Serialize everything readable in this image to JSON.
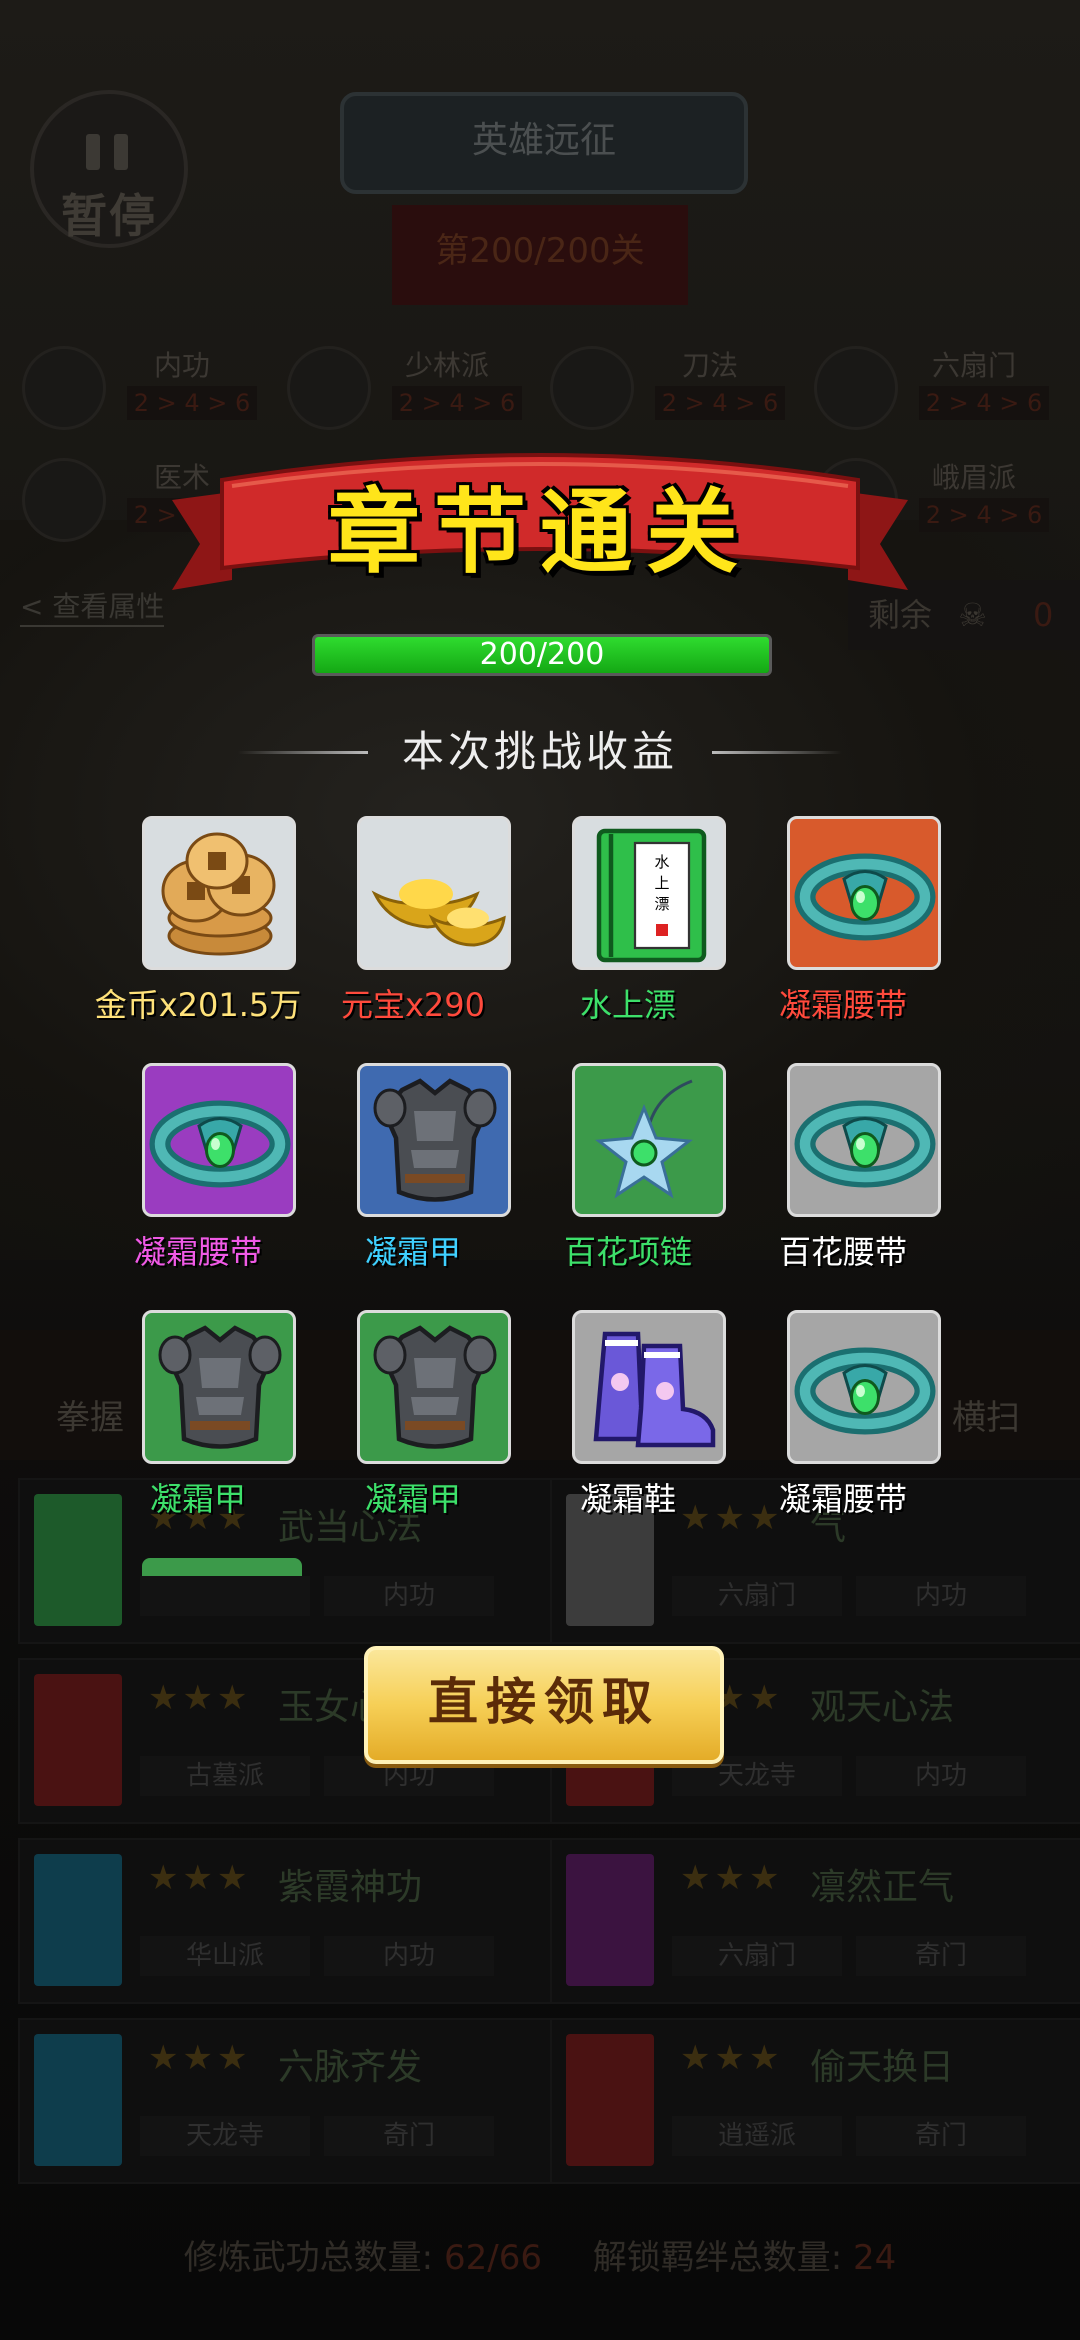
{
  "hud": {
    "pause_label": "暂停",
    "title": "英雄远征",
    "level": "第200/200关"
  },
  "categories": [
    {
      "name": "内功",
      "progress": "2 > 4 > 6"
    },
    {
      "name": "少林派",
      "progress": "2 > 4 > 6"
    },
    {
      "name": "刀法",
      "progress": "2 > 4 > 6"
    },
    {
      "name": "六扇门",
      "progress": "2 > 4 > 6"
    },
    {
      "name": "医术",
      "progress": "2 > 4 > 6"
    },
    {
      "name": "峨眉派",
      "progress": "2 > 4 > 6"
    }
  ],
  "view_attributes": "< 查看属性",
  "remaining": {
    "label": "剩余",
    "value": "0"
  },
  "skill_strip": {
    "left": "拳握",
    "right": "横扫"
  },
  "books": [
    {
      "title": "武当心法",
      "color": "#1d5a2a",
      "tags": [
        "",
        "内功"
      ]
    },
    {
      "title": "气",
      "color": "#3c3c3c",
      "tags": [
        "六扇门",
        "内功"
      ]
    },
    {
      "title": "玉女心经",
      "color": "#4a1212",
      "tags": [
        "古墓派",
        "内功"
      ]
    },
    {
      "title": "观天心法",
      "color": "#4a1212",
      "tags": [
        "天龙寺",
        "内功"
      ]
    },
    {
      "title": "紫霞神功",
      "color": "#0e3d4c",
      "tags": [
        "华山派",
        "内功"
      ]
    },
    {
      "title": "凛然正气",
      "color": "#3b1340",
      "tags": [
        "六扇门",
        "奇门"
      ]
    },
    {
      "title": "六脉齐发",
      "color": "#0e3d4c",
      "tags": [
        "天龙寺",
        "奇门"
      ]
    },
    {
      "title": "偷天换日",
      "color": "#4a1212",
      "tags": [
        "逍遥派",
        "奇门"
      ]
    }
  ],
  "bottom_stats": {
    "label_a": "修炼武功总数量:",
    "value_a": "62/66",
    "label_b": "解锁羁绊总数量:",
    "value_b": "24"
  },
  "popup": {
    "banner": "章节通关",
    "progress_text": "200/200",
    "progress_fraction": 1.0,
    "rewards_title": "本次挑战收益",
    "claim_button": "直接领取"
  },
  "rewards": [
    {
      "label": "金币x201.5万",
      "color": "#ffe27a",
      "bg": "#d8dde0",
      "icon": "coins-icon"
    },
    {
      "label": "元宝x290",
      "color": "#ff4a3c",
      "bg": "#d8dde0",
      "icon": "gold-ingot-icon"
    },
    {
      "label": "水上漂",
      "color": "#3de06a",
      "bg": "#d8dde0",
      "icon": "skill-book-icon"
    },
    {
      "label": "凝霜腰带",
      "color": "#ff4a3c",
      "bg": "#d85a2c",
      "icon": "belt-icon"
    },
    {
      "label": "凝霜腰带",
      "color": "#f05ae6",
      "bg": "#9a3cc0",
      "icon": "belt-icon"
    },
    {
      "label": "凝霜甲",
      "color": "#3fd0ff",
      "bg": "#3f6ab0",
      "icon": "armor-icon"
    },
    {
      "label": "百花项链",
      "color": "#3de06a",
      "bg": "#3c9a4a",
      "icon": "necklace-icon"
    },
    {
      "label": "百花腰带",
      "color": "#ffffff",
      "bg": "#a6a6a6",
      "icon": "belt-icon"
    },
    {
      "label": "凝霜甲",
      "color": "#3de06a",
      "bg": "#3c9a4a",
      "icon": "armor-icon"
    },
    {
      "label": "凝霜甲",
      "color": "#3de06a",
      "bg": "#3c9a4a",
      "icon": "armor-icon"
    },
    {
      "label": "凝霜鞋",
      "color": "#ffffff",
      "bg": "#a6a6a6",
      "icon": "boots-icon"
    },
    {
      "label": "凝霜腰带",
      "color": "#ffffff",
      "bg": "#a6a6a6",
      "icon": "belt-icon"
    }
  ]
}
